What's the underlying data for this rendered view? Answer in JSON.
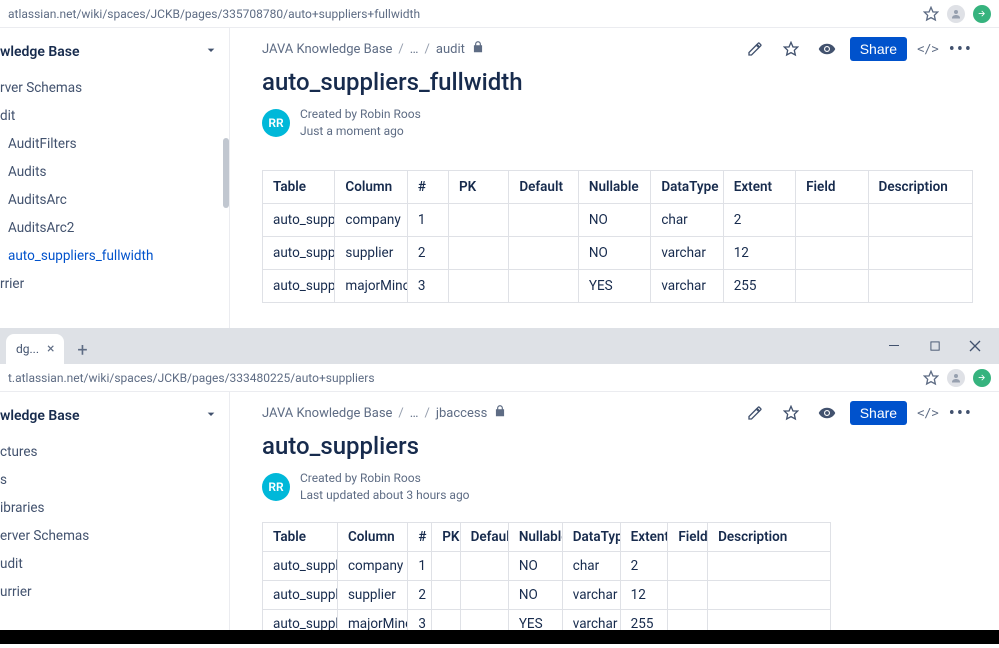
{
  "window1": {
    "url": "atlassian.net/wiki/spaces/JCKB/pages/335708780/auto+suppliers+fullwidth",
    "sidebar": {
      "title": "wledge Base",
      "items": [
        {
          "label": "rver Schemas",
          "lvl": 0
        },
        {
          "label": "dit",
          "lvl": 0
        },
        {
          "label": "AuditFilters",
          "lvl": 1
        },
        {
          "label": "Audits",
          "lvl": 1
        },
        {
          "label": "AuditsArc",
          "lvl": 1
        },
        {
          "label": "AuditsArc2",
          "lvl": 1
        },
        {
          "label": "auto_suppliers_fullwidth",
          "lvl": 1,
          "active": true
        },
        {
          "label": "rrier",
          "lvl": 0
        }
      ]
    },
    "breadcrumb": {
      "space": "JAVA Knowledge Base",
      "parent": "audit"
    },
    "share_label": "Share",
    "embed_label": "</>",
    "page_title": "auto_suppliers_fullwidth",
    "avatar_initials": "RR",
    "created_by": "Created by Robin Roos",
    "timestamp": "Just a moment ago",
    "table": {
      "headers": [
        "Table",
        "Column",
        "#",
        "PK",
        "Default",
        "Nullable",
        "DataType",
        "Extent",
        "Field",
        "Description"
      ],
      "rows": [
        [
          "auto_suppliers",
          "company",
          "1",
          "",
          "",
          "NO",
          "char",
          "2",
          "",
          ""
        ],
        [
          "auto_suppliers",
          "supplier",
          "2",
          "",
          "",
          "NO",
          "varchar",
          "12",
          "",
          ""
        ],
        [
          "auto_supplie",
          "majorMinors",
          "3",
          "",
          "",
          "YES",
          "varchar",
          "255",
          "",
          ""
        ]
      ],
      "widths": [
        "10.2%",
        "10.2%",
        "5.8%",
        "8.5%",
        "9.8%",
        "10.2%",
        "10.2%",
        "10.2%",
        "10.2%",
        "14.7%"
      ]
    }
  },
  "window2": {
    "tab_title": "dg...",
    "url": "t.atlassian.net/wiki/spaces/JCKB/pages/333480225/auto+suppliers",
    "sidebar": {
      "title": "wledge Base",
      "items": [
        {
          "label": "ctures",
          "lvl": 0
        },
        {
          "label": "s",
          "lvl": 0
        },
        {
          "label": "ibraries",
          "lvl": 0
        },
        {
          "label": "erver Schemas",
          "lvl": 0
        },
        {
          "label": "udit",
          "lvl": 0
        },
        {
          "label": "urrier",
          "lvl": 0
        }
      ]
    },
    "breadcrumb": {
      "space": "JAVA Knowledge Base",
      "parent": "jbaccess"
    },
    "share_label": "Share",
    "embed_label": "</>",
    "page_title": "auto_suppliers",
    "avatar_initials": "RR",
    "created_by": "Created by Robin Roos",
    "timestamp": "Last updated about 3 hours ago",
    "table": {
      "headers": [
        "Table",
        "Column",
        "#",
        "PK",
        "Default",
        "Nullable",
        "DataType",
        "Extent",
        "Field",
        "Description"
      ],
      "rows": [
        [
          "auto_suppliers",
          "company",
          "1",
          "",
          "",
          "NO",
          "char",
          "2",
          "",
          ""
        ],
        [
          "auto_suppliers",
          "supplier",
          "2",
          "",
          "",
          "NO",
          "varchar",
          "12",
          "",
          ""
        ],
        [
          "auto_suppliers",
          "majorMinors",
          "3",
          "",
          "",
          "YES",
          "varchar",
          "255",
          "",
          ""
        ]
      ],
      "widths": [
        "13.2%",
        "12.4%",
        "4.2%",
        "5%",
        "8.5%",
        "9.5%",
        "10.2%",
        "8.4%",
        "7%",
        "21.6%"
      ]
    }
  }
}
